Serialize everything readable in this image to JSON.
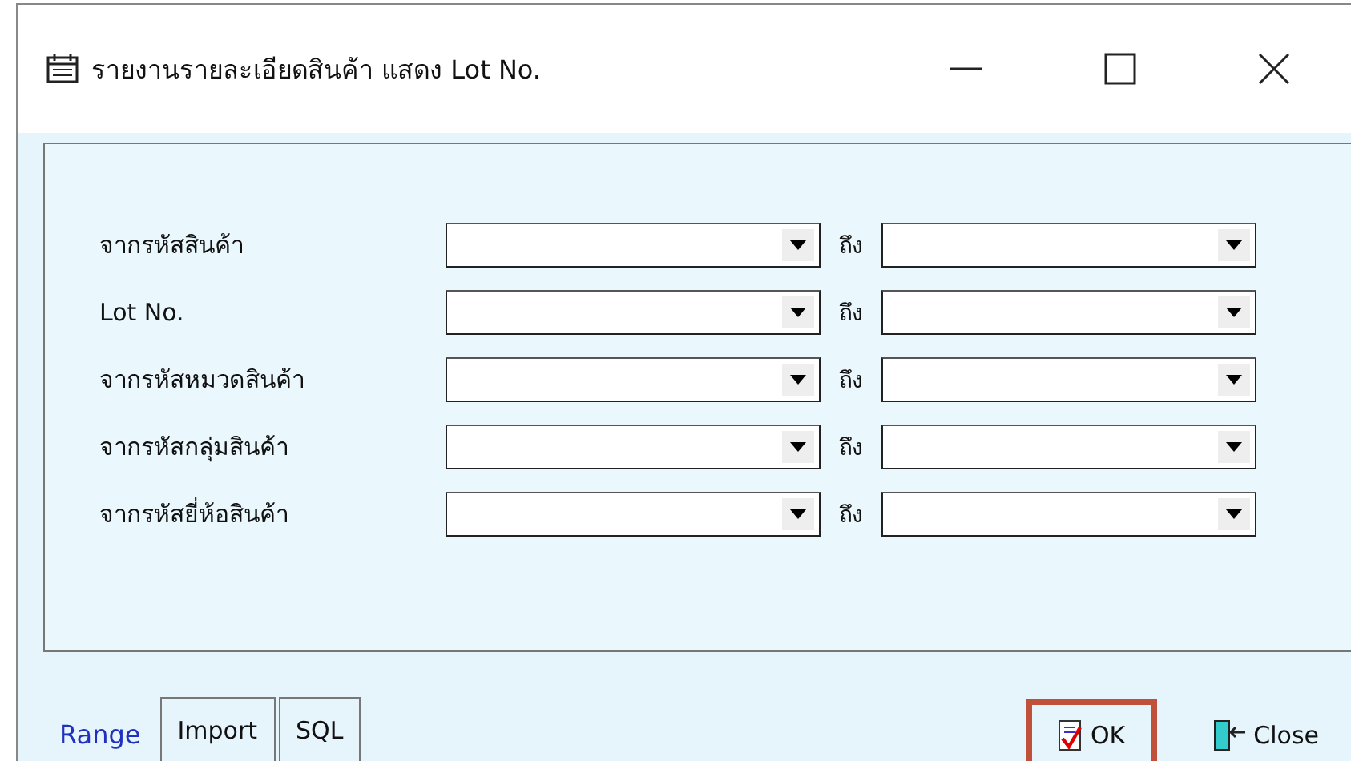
{
  "window": {
    "title": "รายงานรายละเอียดสินค้า แสดง Lot No."
  },
  "fields": [
    {
      "label": "จากรหัสสินค้า",
      "to_label": "ถึง"
    },
    {
      "label": "Lot No.",
      "to_label": "ถึง"
    },
    {
      "label": "จากรหัสหมวดสินค้า",
      "to_label": "ถึง"
    },
    {
      "label": "จากรหัสกลุ่มสินค้า",
      "to_label": "ถึง"
    },
    {
      "label": "จากรหัสยี่ห้อสินค้า",
      "to_label": "ถึง"
    }
  ],
  "tabs": [
    {
      "label": "Range",
      "selected": true
    },
    {
      "label": "Import",
      "selected": false
    },
    {
      "label": "SQL",
      "selected": false
    }
  ],
  "buttons": [
    {
      "label": "OK",
      "kind": "ok",
      "highlighted": true
    },
    {
      "label": "Close",
      "kind": "close",
      "highlighted": false
    }
  ]
}
